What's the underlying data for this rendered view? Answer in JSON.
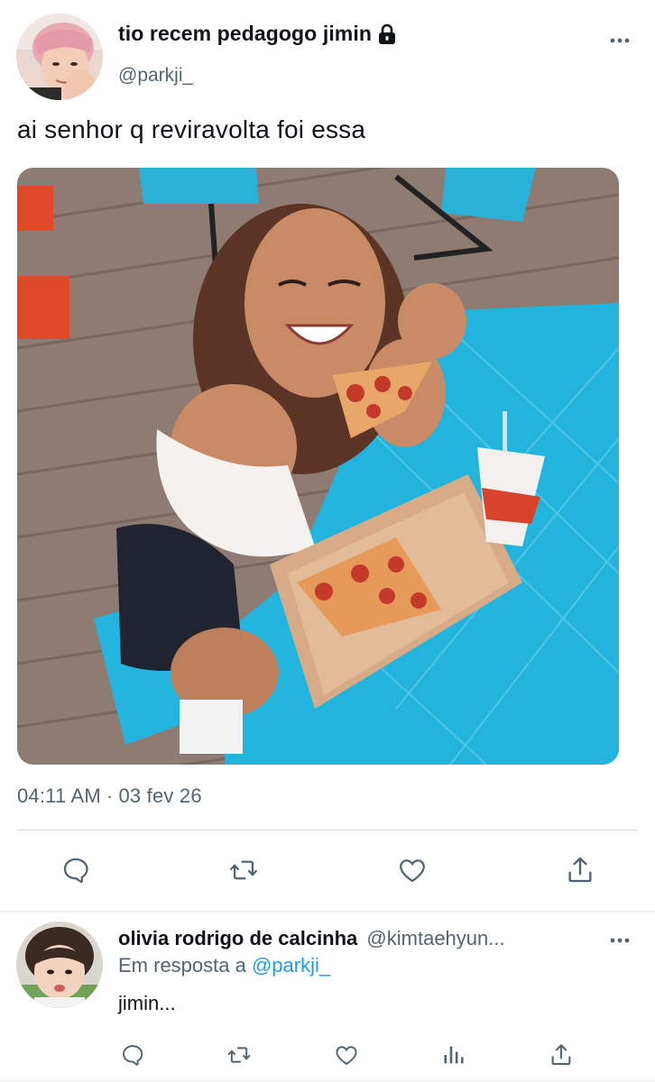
{
  "tweet": {
    "author_name": "tio recem pedagogo jimin",
    "author_handle": "@parkji_",
    "protected_icon": "lock-icon",
    "text": "ai senhor q reviravolta foi essa",
    "media_description_icon": "photo",
    "time": "04:11 AM",
    "separator": "·",
    "date": "03 fev 26",
    "actions": [
      "reply-icon",
      "retweet-icon",
      "like-icon",
      "share-icon"
    ]
  },
  "reply": {
    "author_name": "olivia rodrigo de calcinha",
    "author_handle": "@kimtaehyun...",
    "reply_prefix": "Em resposta a",
    "reply_mention": "@parkji_",
    "text": "jimin...",
    "actions": [
      "reply-icon",
      "retweet-icon",
      "like-icon",
      "analytics-icon",
      "share-icon"
    ]
  },
  "colors": {
    "text_primary": "#0f1419",
    "text_secondary": "#536471",
    "link": "#1d9bf0",
    "divider": "#cfd9de"
  }
}
